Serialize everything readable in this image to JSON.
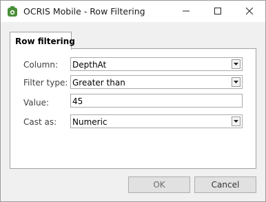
{
  "window": {
    "title": "OCRIS Mobile - Row Filtering"
  },
  "tab": {
    "label": "Row filtering"
  },
  "form": {
    "column_label": "Column:",
    "column_value": "DepthAt",
    "filter_type_label": "Filter type:",
    "filter_type_value": "Greater than",
    "value_label": "Value:",
    "value_value": "45",
    "cast_as_label": "Cast as:",
    "cast_as_value": "Numeric"
  },
  "buttons": {
    "ok": "OK",
    "cancel": "Cancel"
  },
  "icons": {
    "app": "ocris-app-icon",
    "minimize": "minimize-icon",
    "maximize": "maximize-icon",
    "close": "close-icon",
    "dropdown": "chevron-down-icon"
  },
  "colors": {
    "app_icon": "#4a8f3a",
    "window_bg": "#f0f0f0",
    "panel_bg": "#ffffff",
    "button_bg": "#e1e1e1"
  }
}
